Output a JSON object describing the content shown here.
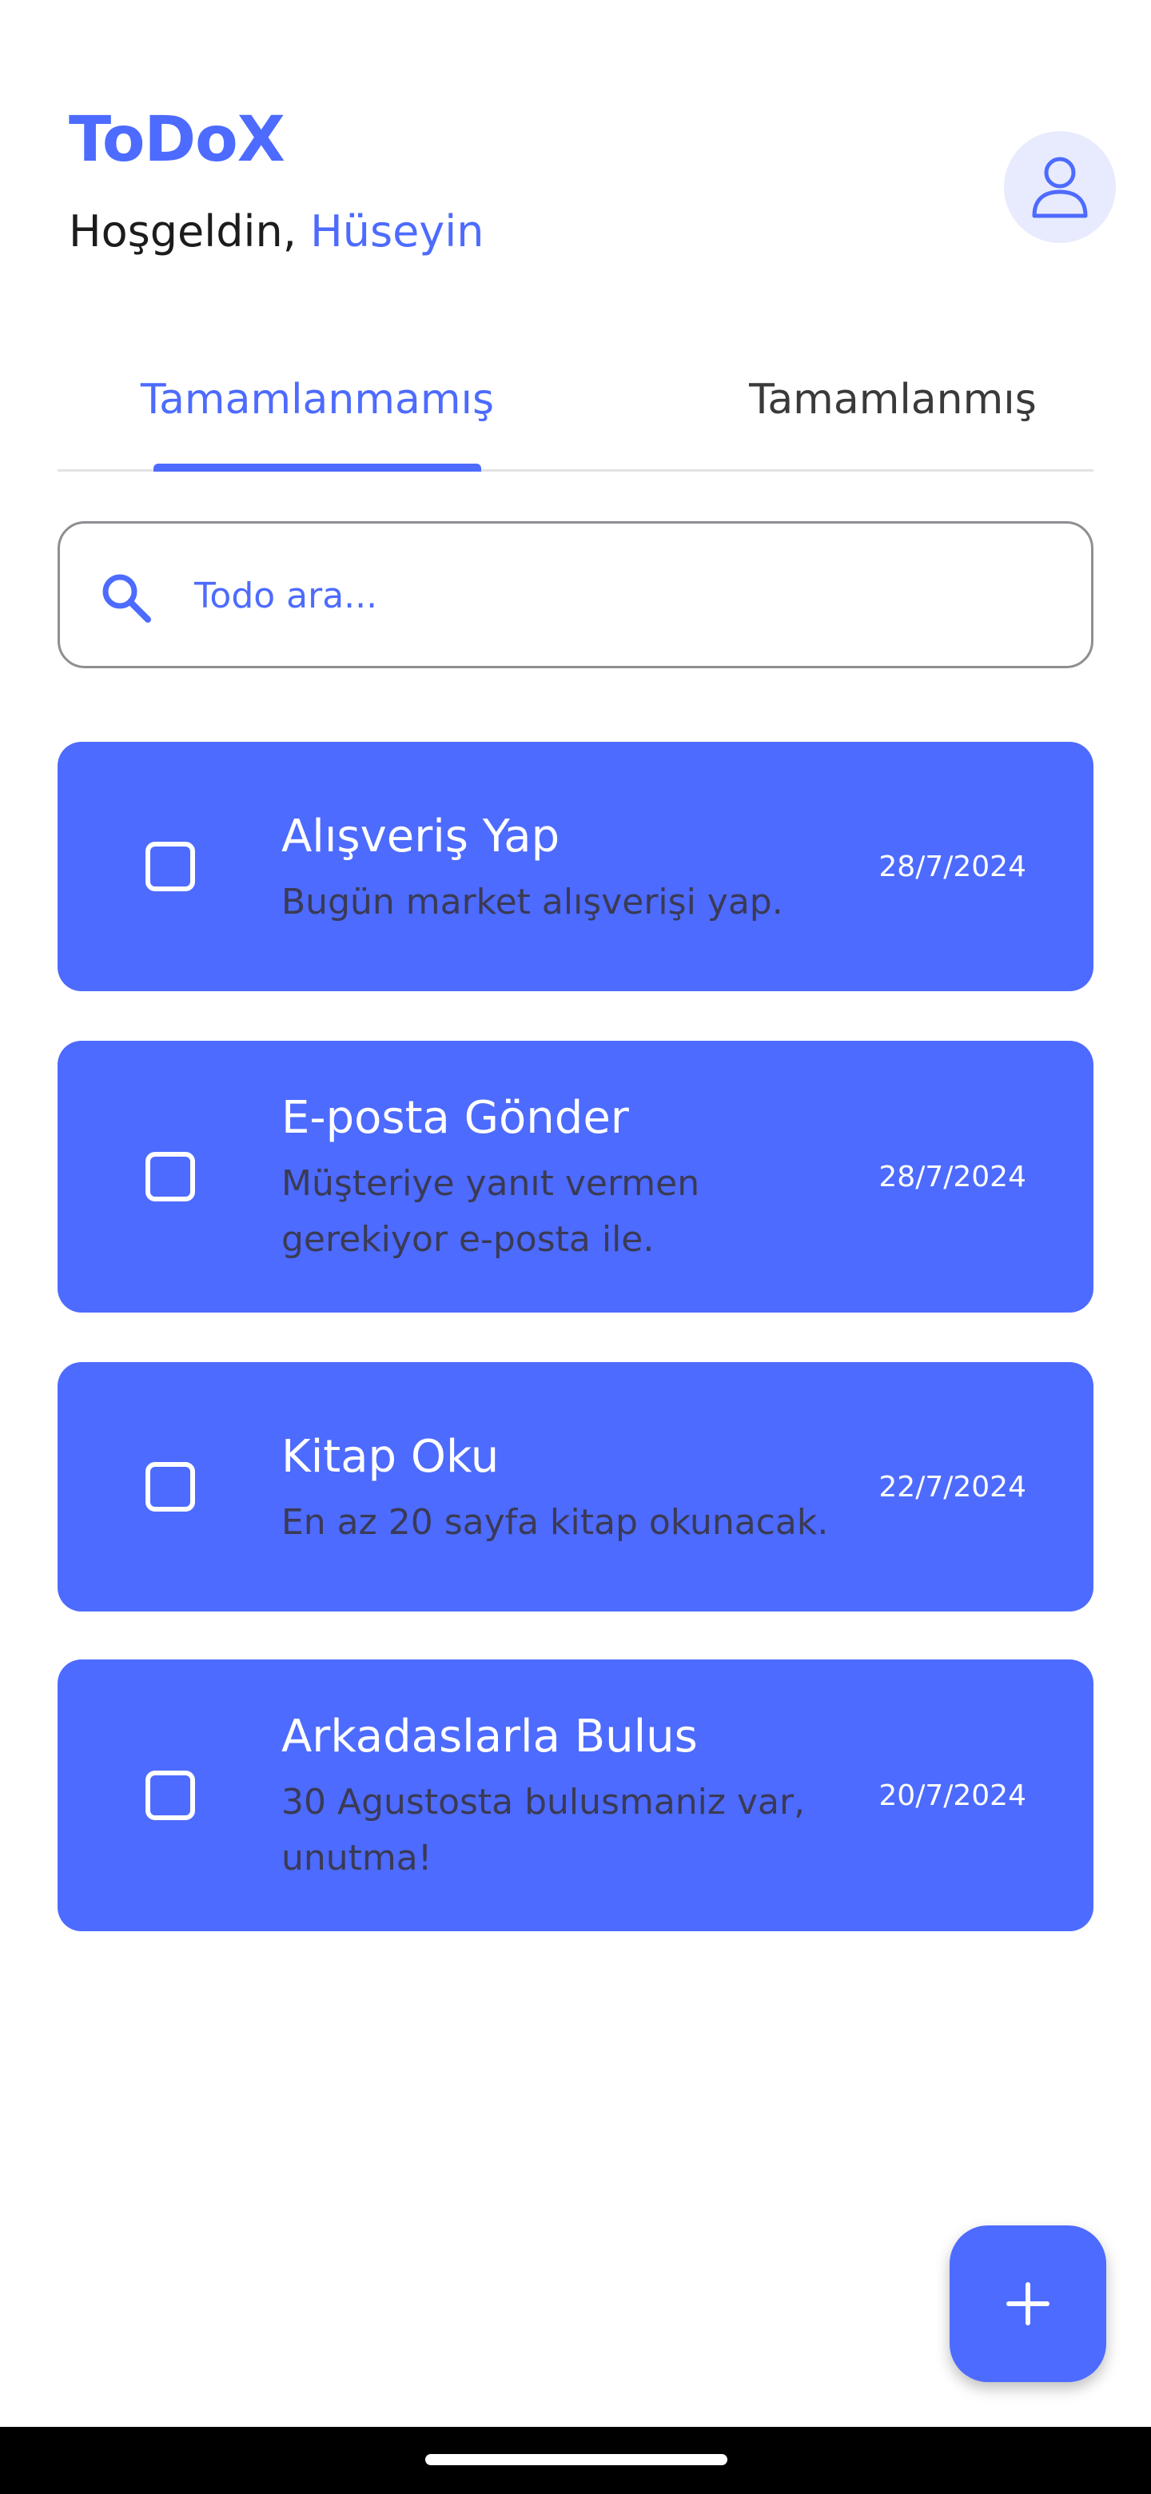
{
  "header": {
    "app_title": "ToDoX",
    "greeting_prefix": "Hoşgeldin,",
    "user_name": "Hüseyin"
  },
  "tabs": [
    {
      "label": "Tamamlanmamış",
      "active": true
    },
    {
      "label": "Tamamlanmış",
      "active": false
    }
  ],
  "search": {
    "placeholder": "Todo ara..."
  },
  "todos": [
    {
      "title": "Alışveriş Yap",
      "description": "Bugün market alışverişi yap.",
      "date": "28/7/2024",
      "checked": false
    },
    {
      "title": "E-posta Gönder",
      "description": "Müşteriye yanıt vermen gerekiyor e-posta ile.",
      "date": "28/7/2024",
      "checked": false
    },
    {
      "title": "Kitap Oku",
      "description": "En az 20 sayfa kitap okunacak.",
      "date": "22/7/2024",
      "checked": false
    },
    {
      "title": "Arkadaslarla Bulus",
      "description": "30 Agustosta bulusmaniz var, unutma!",
      "date": "20/7/2024",
      "checked": false
    }
  ],
  "colors": {
    "accent": "#4d6bfe",
    "avatar_bg": "#e8ebfd",
    "description_text": "#3a3a55"
  },
  "icons": {
    "avatar": "user-icon",
    "search": "search-icon",
    "fab": "plus-icon"
  }
}
